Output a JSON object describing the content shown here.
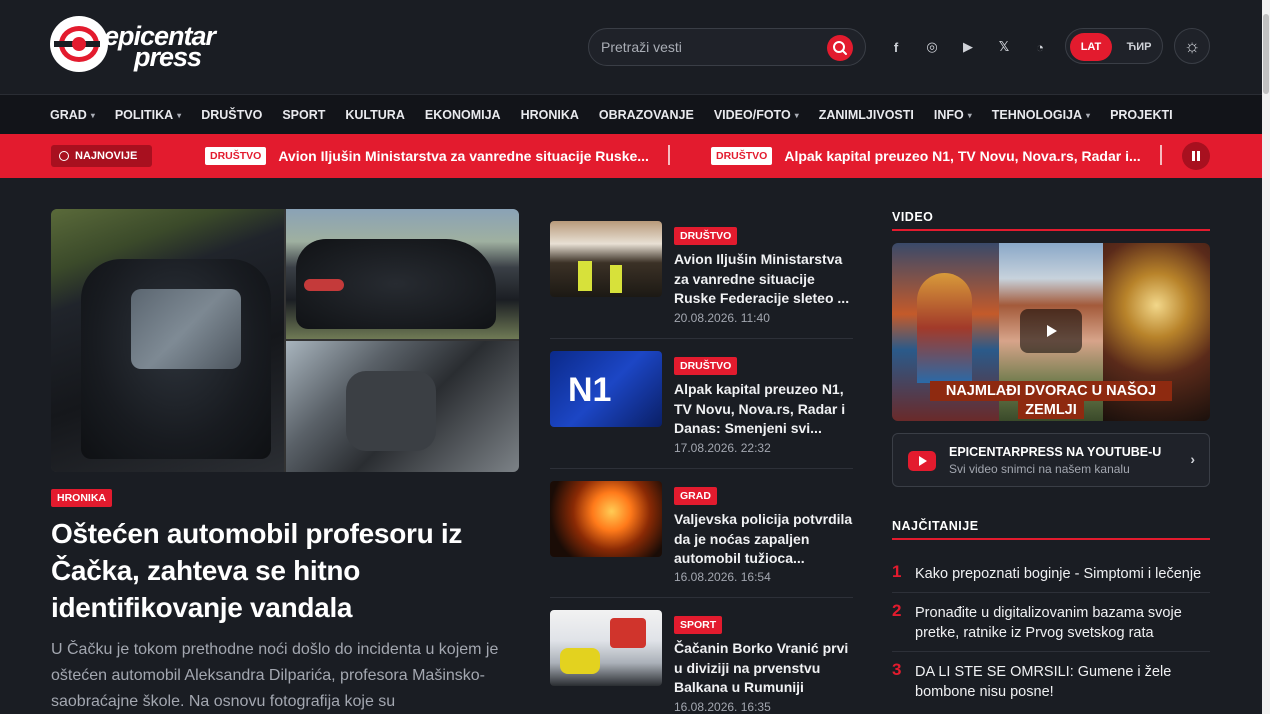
{
  "brand": {
    "logo_line1": "epicentar",
    "logo_line2": "press"
  },
  "search": {
    "placeholder": "Pretraži vesti"
  },
  "socials": [
    {
      "name": "facebook-icon",
      "glyph": "f"
    },
    {
      "name": "instagram-icon",
      "glyph": "◎"
    },
    {
      "name": "youtube-icon",
      "glyph": "▶"
    },
    {
      "name": "x-icon",
      "glyph": "𝕏"
    },
    {
      "name": "rss-icon",
      "glyph": "◔"
    }
  ],
  "lang": {
    "lat": "LAT",
    "cyr": "ЋИР"
  },
  "theme": {
    "glyph": "☼"
  },
  "nav": [
    {
      "label": "GRAD",
      "dropdown": true
    },
    {
      "label": "POLITIKA",
      "dropdown": true
    },
    {
      "label": "DRUŠTVO",
      "dropdown": false
    },
    {
      "label": "SPORT",
      "dropdown": false
    },
    {
      "label": "KULTURA",
      "dropdown": false
    },
    {
      "label": "EKONOMIJA",
      "dropdown": false
    },
    {
      "label": "HRONIKA",
      "dropdown": false
    },
    {
      "label": "OBRAZOVANJE",
      "dropdown": false
    },
    {
      "label": "VIDEO/FOTO",
      "dropdown": true
    },
    {
      "label": "ZANIMLJIVOSTI",
      "dropdown": false
    },
    {
      "label": "INFO",
      "dropdown": true
    },
    {
      "label": "TEHNOLOGIJA",
      "dropdown": true
    },
    {
      "label": "PROJEKTI",
      "dropdown": false
    }
  ],
  "ticker": {
    "latest_label": "NAJNOVIJE",
    "items": [
      {
        "tag": "DRUŠTVO",
        "title": "Avion Iljušin Ministarstva za vanredne situacije Ruske..."
      },
      {
        "tag": "DRUŠTVO",
        "title": "Alpak kapital preuzeo N1, TV Novu, Nova.rs, Radar i..."
      }
    ]
  },
  "hero": {
    "tag": "HRONIKA",
    "title": "Oštećen automobil profesoru iz Čačka, zahteva se hitno identifikovanje vandala",
    "lead": "U Čačku je tokom prethodne noći došlo do incidenta u kojem je oštećen automobil Aleksandra Dilparića, profesora Mašinsko-saobraćajne škole. Na osnovu fotografija koje su"
  },
  "news": [
    {
      "tag": "DRUŠTVO",
      "title": "Avion Iljušin Ministarstva za vanredne situacije Ruske Federacije sleteo ...",
      "date": "20.08.2026. 11:40"
    },
    {
      "tag": "DRUŠTVO",
      "title": "Alpak kapital preuzeo N1, TV Novu, Nova.rs, Radar i Danas: Smenjeni svi...",
      "date": "17.08.2026. 22:32",
      "thumb_text": "N1"
    },
    {
      "tag": "GRAD",
      "title": "Valjevska policija potvrdila da je noćas zapaljen automobil tužioca...",
      "date": "16.08.2026. 16:54"
    },
    {
      "tag": "SPORT",
      "title": "Čačanin Borko Vranić prvi u diviziji na prvenstvu Balkana u Rumuniji",
      "date": "16.08.2026. 16:35"
    }
  ],
  "video": {
    "section_title": "VIDEO",
    "caption_line1": "NAJMLAĐI DVORAC U NAŠOJ",
    "caption_line2": "ZEMLJI"
  },
  "youtube": {
    "title": "EPICENTARPRESS NA YOUTUBE-U",
    "subtitle": "Svi video snimci na našem kanalu",
    "chevron": "›"
  },
  "popular": {
    "section_title": "NAJČITANIJE",
    "items": [
      {
        "num": "1",
        "text": "Kako prepoznati boginje - Simptomi i lečenje"
      },
      {
        "num": "2",
        "text": "Pronađite u digitalizovanim bazama svoje pretke, ratnike iz Prvog svetskog rata"
      },
      {
        "num": "3",
        "text": "DA LI STE SE OMRSILI: Gumene i žele bombone nisu posne!"
      }
    ]
  },
  "colors": {
    "accent": "#e31b2e",
    "background": "#1a1d23",
    "nav_bg": "#121419"
  }
}
